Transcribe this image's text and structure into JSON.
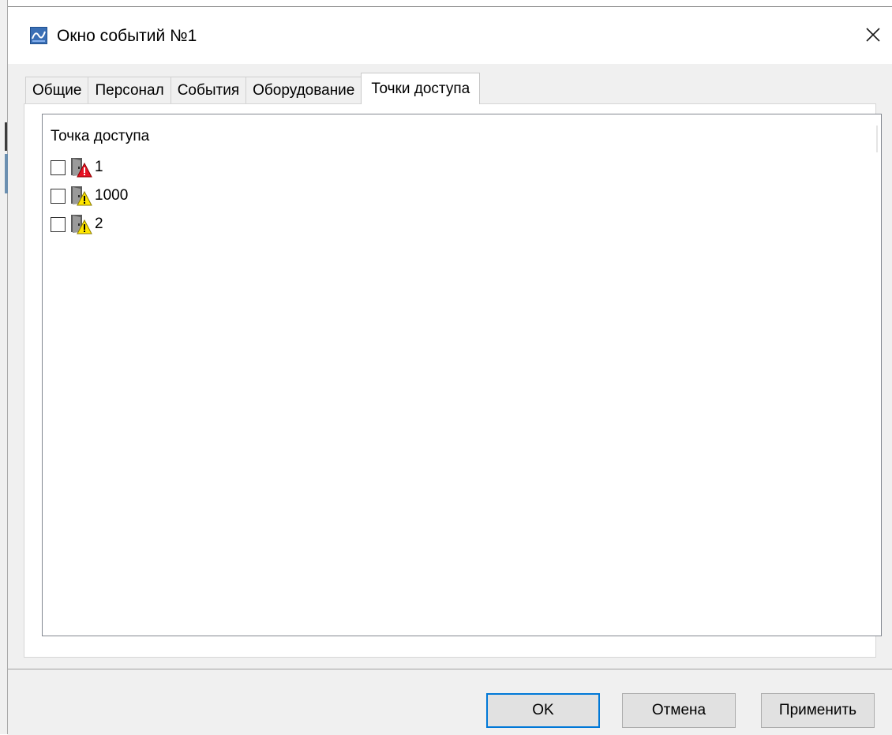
{
  "window": {
    "title": "Окно событий №1",
    "icon": "app-icon",
    "close_icon": "close-icon"
  },
  "tabs": [
    {
      "label": "Общие",
      "active": false
    },
    {
      "label": "Персонал",
      "active": false
    },
    {
      "label": "События",
      "active": false
    },
    {
      "label": "Оборудование",
      "active": false
    },
    {
      "label": "Точки доступа",
      "active": true
    }
  ],
  "tree": {
    "header": "Точка доступа",
    "items": [
      {
        "label": "1",
        "checked": false,
        "icon": "door-alarm-icon",
        "status_color": "#e81123"
      },
      {
        "label": "1000",
        "checked": false,
        "icon": "door-warning-icon",
        "status_color": "#ffe600"
      },
      {
        "label": "2",
        "checked": false,
        "icon": "door-warning-icon",
        "status_color": "#ffe600"
      }
    ]
  },
  "buttons": {
    "ok": "OK",
    "cancel": "Отмена",
    "apply": "Применить"
  },
  "colors": {
    "focus_border": "#0078d7",
    "dialog_bg": "#f0f0f0"
  }
}
